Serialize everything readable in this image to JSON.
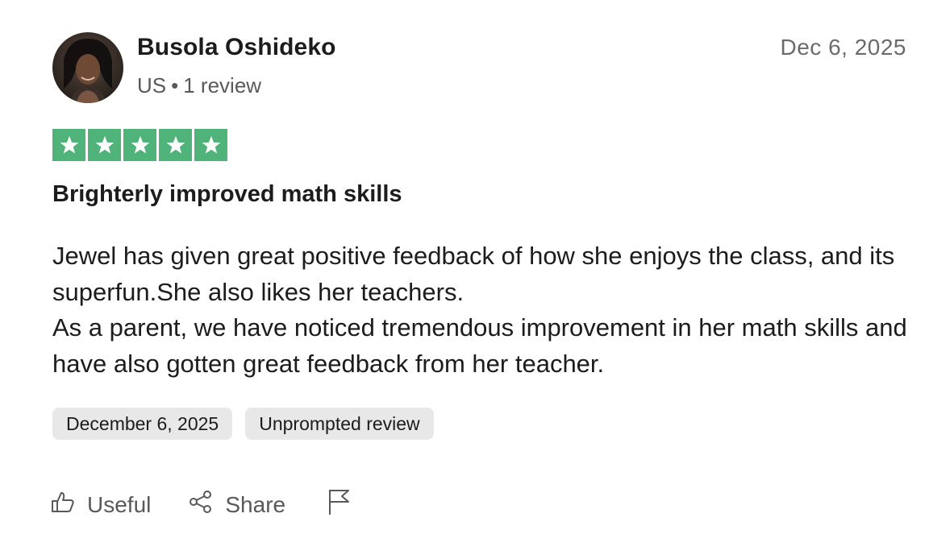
{
  "reviewer": {
    "name": "Busola Oshideko",
    "country": "US",
    "separator": "•",
    "review_count": "1 review"
  },
  "review": {
    "date_short": "Dec 6, 2025",
    "rating": 5,
    "rating_max": 5,
    "star_color": "#50b47a",
    "title": "Brighterly improved math skills",
    "body_lines": [
      "Jewel has given great positive feedback of how she enjoys the class, and its superfun.She also likes her teachers.",
      "As a parent, we have noticed tremendous improvement in her math skills and have also gotten great feedback from her teacher."
    ],
    "tags": [
      "December 6, 2025",
      "Unprompted review"
    ]
  },
  "actions": {
    "useful_label": "Useful",
    "useful_icon": "thumbs-up-icon",
    "share_label": "Share",
    "share_icon": "share-icon",
    "flag_icon": "flag-icon"
  }
}
